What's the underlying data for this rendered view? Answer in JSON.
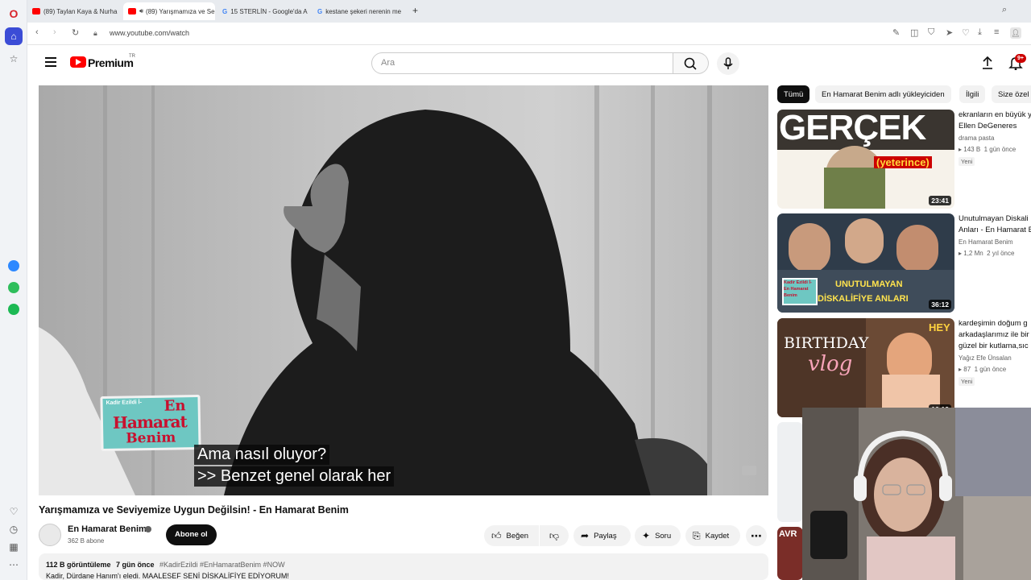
{
  "browser": {
    "tabs": [
      {
        "label": "(89) Taylan Kaya & Nurha"
      },
      {
        "label": "(89) Yarışmamıza ve Se"
      },
      {
        "label": "15 STERLİN - Google'da A"
      },
      {
        "label": "kestane şekeri nerenin me"
      }
    ],
    "new_tab": "+",
    "url": "www.youtube.com/watch"
  },
  "youtube": {
    "logo_text": "Premium",
    "country": "TR",
    "search_placeholder": "Ara",
    "notification_count": "9+"
  },
  "video": {
    "captions": [
      "Ama nasıl oluyor?",
      ">> Benzet genel olarak her"
    ],
    "show_logo": {
      "line1": "Kadir Ezildi İ-",
      "line2": "En",
      "line3": "Hamarat",
      "line4": "Benim"
    },
    "title": "Yarışmamıza ve Seviyemize Uygun Değilsin! - En Hamarat Benim",
    "channel": "En Hamarat Benim",
    "subscribers": "362 B abone",
    "subscribe_label": "Abone ol",
    "like_label": "Beğen",
    "share_label": "Paylaş",
    "ask_label": "Soru",
    "save_label": "Kaydet",
    "views": "112 B görüntüleme",
    "age": "7 gün önce",
    "tags": "#KadirEzildi #EnHamaratBenim #NOW",
    "desc_line": "Kadir, Dürdane Hanım'ı eledi. MAALESEF SENİ DİSKALİFİYE EDİYORUM!"
  },
  "chips": [
    "Tümü",
    "En Hamarat Benim adlı yükleyiciden",
    "İlgili",
    "Size özel"
  ],
  "recommended": [
    {
      "title1": "ekranların en büyük y",
      "title2": "Ellen DeGeneres",
      "channel": "drama pasta",
      "views": "143 B",
      "age": "1 gün önce",
      "badge": "Yeni",
      "duration": "23:41",
      "thumb_text": "GERÇEK",
      "thumb_sub": "(yeterince)"
    },
    {
      "title1": "Unutulmayan Diskali",
      "title2": "Anları - En Hamarat B",
      "channel": "En Hamarat Benim",
      "views": "1,2 Mn",
      "age": "2 yıl önce",
      "duration": "36:12",
      "thumb_text": "UNUTULMAYAN",
      "thumb_sub": "DİSKALİFİYE ANLARI",
      "thumb_logo": "Kadir Ezildi İ- En Hamarat Benim"
    },
    {
      "title1": "kardeşimin doğum g",
      "title2": "arkadaşlarımız ile bir",
      "title3": "güzel bir kutlama,sıc",
      "channel": "Yağız Efe Ünsalan",
      "views": "87",
      "age": "1 gün önce",
      "badge": "Yeni",
      "duration": "16:12",
      "thumb_text": "BIRTHDAY",
      "thumb_sub": "vlog",
      "thumb_hey": "HEY"
    }
  ],
  "partial_thumb_text": "AVR"
}
